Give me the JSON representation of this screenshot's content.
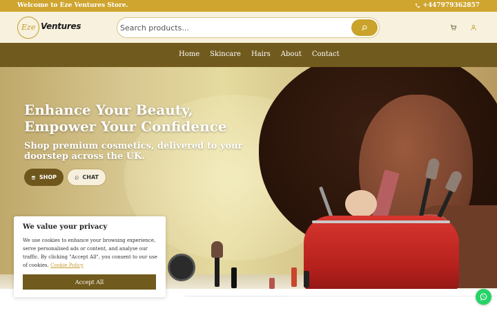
{
  "topbar": {
    "welcome": "Welcome to Eze Ventures Store.",
    "phone": "+447979362857",
    "phone_icon": "phone-icon"
  },
  "header": {
    "logo_script": "Eze",
    "logo_word": "Ventures",
    "search_placeholder": "Search products...",
    "search_icon": "search-icon",
    "cart_icon": "cart-icon",
    "account_icon": "user-icon"
  },
  "nav": {
    "items": [
      {
        "label": "Home"
      },
      {
        "label": "Skincare"
      },
      {
        "label": "Hairs"
      },
      {
        "label": "About"
      },
      {
        "label": "Contact"
      }
    ]
  },
  "hero": {
    "title_line1": "Enhance Your Beauty,",
    "title_line2": "Empower Your Confidence",
    "subtitle": "Shop premium cosmetics, delivered to your doorstep across the UK.",
    "shop_label": "SHOP",
    "chat_label": "CHAT"
  },
  "cookie": {
    "title": "We value your privacy",
    "text": "We use cookies to enhance your browsing experience, serve personalised ads or content, and analyse our traffic. By clicking \"Accept All\", you consent to our use of cookies.",
    "link": "Cookie Policy",
    "accept_label": "Accept All"
  },
  "colors": {
    "gold": "#cfa52f",
    "brown": "#715a1d",
    "cream": "#f7f1de",
    "whatsapp": "#25d366"
  }
}
